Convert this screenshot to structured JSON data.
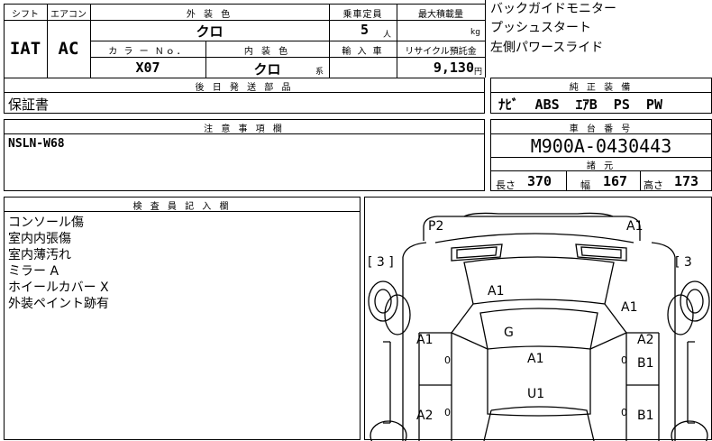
{
  "spec_table": {
    "headers": {
      "shift": "シフト",
      "aircon": "エアコン",
      "exterior_color": "外 装 色",
      "capacity": "乗車定員",
      "max_load": "最大積載量",
      "color_no": "カ ラ ー Ｎｏ．",
      "interior_color": "内 装 色",
      "import": "輸 入 車",
      "recycle": "リサイクル預託金"
    },
    "values": {
      "shift": "IAT",
      "aircon": "AC",
      "exterior_color": "クロ",
      "capacity": "5",
      "capacity_unit": "人",
      "max_load_unit": "kg",
      "color_no": "X07",
      "interior_color": "クロ",
      "interior_suffix": "系",
      "recycle": "9,130",
      "recycle_unit": "円"
    }
  },
  "features": [
    "バックガイドモニター",
    "プッシュスタート",
    "左側パワースライド"
  ],
  "later_parts": {
    "header": "後 日 発 送 部 品",
    "value": "保証書"
  },
  "genuine_equipment": {
    "header": "純 正 装 備",
    "value": "ﾅﾋﾞ  ABS  ｴｱB  PS  PW"
  },
  "notes": {
    "header": "注 意 事 項 欄",
    "value": "NSLN-W68"
  },
  "chassis": {
    "header": "車 台 番 号",
    "value": "M900A-0430443"
  },
  "dimensions": {
    "header": "諸 元",
    "length_label": "長さ",
    "length": "370",
    "width_label": "幅",
    "width": "167",
    "height_label": "高さ",
    "height": "173"
  },
  "inspector_notes": {
    "header": "検 査 員 記 入 欄",
    "lines": [
      "コンソール傷",
      "室内内張傷",
      "室内薄汚れ",
      "ミラー A",
      "ホイールカバー X",
      "外装ペイント跡有"
    ]
  },
  "diagram": {
    "marks": {
      "p2": "P2",
      "a1_top": "A1",
      "bracket_left": "[ 3 ]",
      "bracket_right": "[ 3",
      "a1_hood": "A1",
      "a1_right_front": "A1",
      "g": "G",
      "a1_left_door": "A1",
      "a2_right_door": "A2",
      "a1_roof": "A1",
      "b1_right_1": "B1",
      "u1": "U1",
      "a2_left_rear": "A2",
      "b1_right_2": "B1",
      "zero_left_1": "0",
      "zero_right_1": "0",
      "zero_left_2": "0",
      "zero_right_2": "0"
    }
  }
}
